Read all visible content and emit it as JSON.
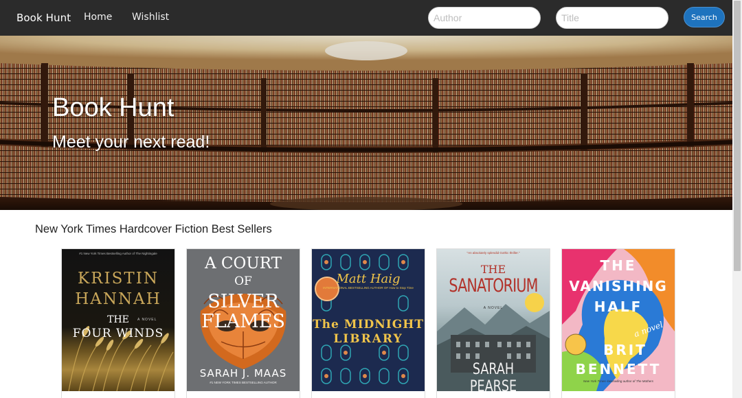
{
  "nav": {
    "brand": "Book Hunt",
    "home": "Home",
    "wishlist": "Wishlist",
    "author_placeholder": "Author",
    "title_placeholder": "Title",
    "search_label": "Search"
  },
  "hero": {
    "title": "Book Hunt",
    "subtitle": "Meet your next read!"
  },
  "section": {
    "title": "New York Times Hardcover Fiction Best Sellers"
  },
  "books": [
    {
      "tagline": "#1 New York Times Bestselling Author of The Nightingale",
      "author_line1": "KRISTIN",
      "author_line2": "HANNAH",
      "title_line1": "THE",
      "title_line2": "FOUR WINDS",
      "badge": "A NOVEL"
    },
    {
      "title_line1": "A COURT",
      "title_line2": "OF",
      "title_line3": "SILVER",
      "title_line4": "FLAMES",
      "author": "SARAH J. MAAS",
      "tagline": "#1 NEW YORK TIMES BESTSELLING AUTHOR"
    },
    {
      "author": "Matt Haig",
      "tagline": "INTERNATIONAL BESTSELLING AUTHOR OF How to Stop Time",
      "title_line1": "The MIDNIGHT",
      "title_line2": "LIBRARY"
    },
    {
      "tagline": "\"An absolutely splendid Gothic thriller.\"",
      "title_line1": "THE",
      "title_line2": "SANATORIUM",
      "badge": "A NOVEL",
      "author": "SARAH PEARSE"
    },
    {
      "title_line1": "THE",
      "title_line2": "VANISHING",
      "title_line3": "HALF",
      "badge": "a novel",
      "author_line1": "BRIT",
      "author_line2": "BENNETT",
      "tagline": "New York Times–bestselling author of The Mothers"
    }
  ]
}
